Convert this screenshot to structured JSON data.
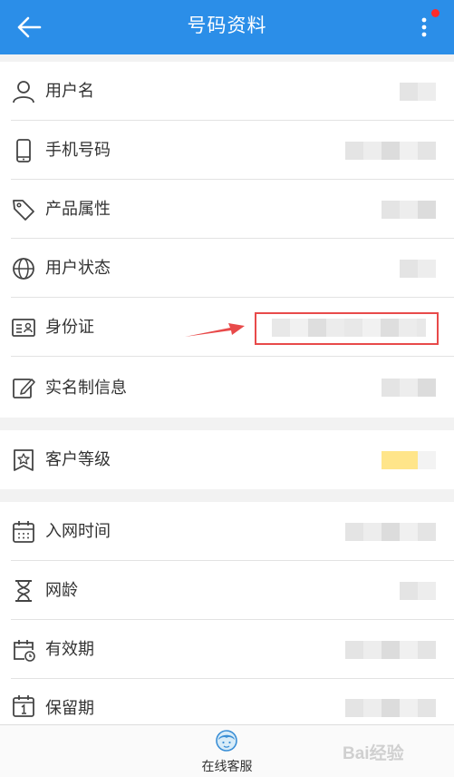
{
  "header": {
    "title": "号码资料",
    "back_icon": "arrow-left-icon",
    "more_icon": "more-vertical-icon",
    "notification_dot_color": "#ff2a2a",
    "background_color": "#2b8ee8"
  },
  "rows": [
    {
      "label": "用户名",
      "icon": "user-icon"
    },
    {
      "label": "手机号码",
      "icon": "phone-icon"
    },
    {
      "label": "产品属性",
      "icon": "tag-icon"
    },
    {
      "label": "用户状态",
      "icon": "globe-icon"
    },
    {
      "label": "身份证",
      "icon": "id-card-icon"
    },
    {
      "label": "实名制信息",
      "icon": "edit-icon"
    },
    {
      "label": "客户等级",
      "icon": "star-badge-icon"
    },
    {
      "label": "入网时间",
      "icon": "calendar-icon"
    },
    {
      "label": "网龄",
      "icon": "hourglass-icon"
    },
    {
      "label": "有效期",
      "icon": "calendar-clock-icon"
    },
    {
      "label": "保留期",
      "icon": "calendar-one-icon"
    }
  ],
  "annotation": {
    "highlight_color": "#e84a4a"
  },
  "footer": {
    "customer_service_label": "在线客服",
    "customer_service_icon": "customer-service-icon"
  },
  "watermark": {
    "text": "Bai经验"
  }
}
